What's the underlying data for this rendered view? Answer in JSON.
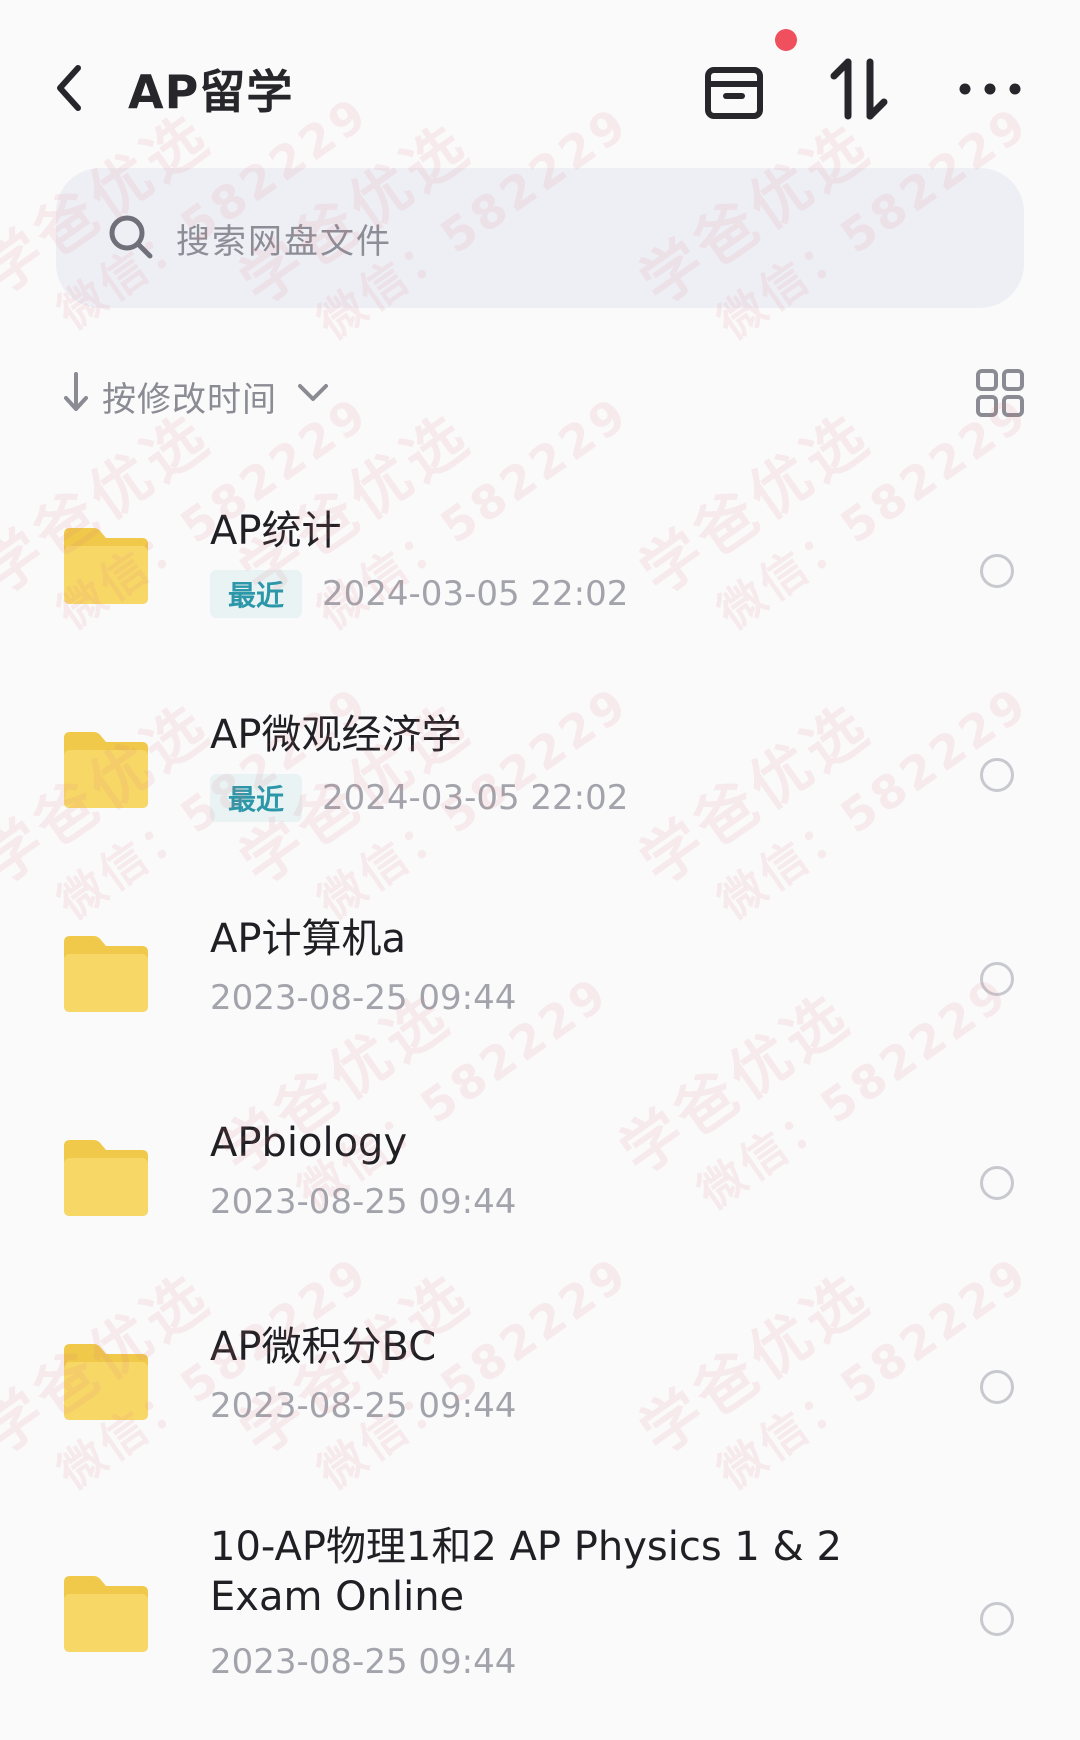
{
  "header": {
    "title": "AP留学",
    "back_icon": "chevron-left-icon",
    "archive_icon": "archive-box-icon",
    "sort_icon": "sort-arrows-icon",
    "more_icon": "more-dots-icon",
    "notification_dot_color": "#f0505e"
  },
  "search": {
    "placeholder": "搜索网盘文件",
    "icon": "search-icon"
  },
  "sort": {
    "label": "按修改时间",
    "direction_icon": "arrow-down-icon",
    "dropdown_icon": "chevron-down-icon",
    "view_toggle_icon": "grid-view-icon"
  },
  "files": [
    {
      "name": "AP统计",
      "badge": "最近",
      "date": "2024-03-05  22:02"
    },
    {
      "name": "AP微观经济学",
      "badge": "最近",
      "date": "2024-03-05  22:02"
    },
    {
      "name": "AP计算机a",
      "badge": "",
      "date": "2023-08-25  09:44"
    },
    {
      "name": "APbiology",
      "badge": "",
      "date": "2023-08-25  09:44"
    },
    {
      "name": "AP微积分BC",
      "badge": "",
      "date": "2023-08-25  09:44"
    },
    {
      "name": "10-AP物理1和2 AP Physics 1 & 2 Exam Online",
      "badge": "",
      "date": "2023-08-25  09:44"
    }
  ],
  "watermark": {
    "line1": "学爸优选",
    "line2": "微信：582229"
  },
  "colors": {
    "folder": "#f7d867",
    "badge_text": "#2b97a8",
    "badge_bg": "#e9f3f4"
  }
}
